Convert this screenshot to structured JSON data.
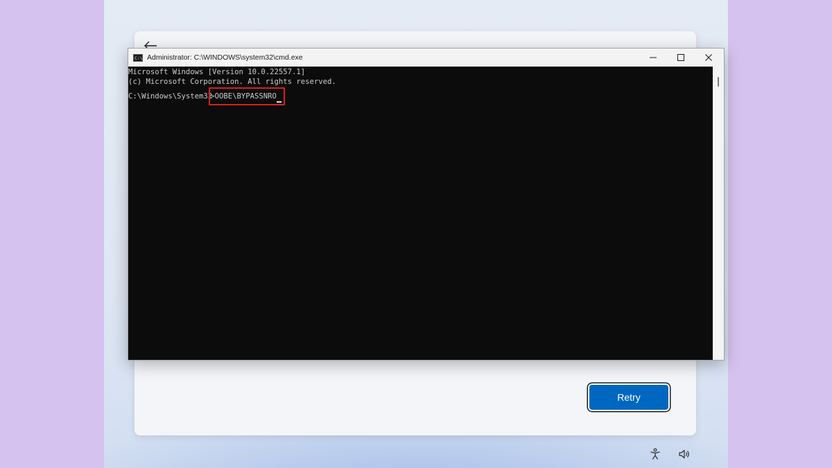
{
  "cmd": {
    "title": "Administrator: C:\\WINDOWS\\system32\\cmd.exe",
    "icon_text": "C:\\",
    "lines": [
      "Microsoft Windows [Version 10.0.22557.1]",
      "(c) Microsoft Corporation. All rights reserved."
    ],
    "prompt": "C:\\Windows\\System32",
    "command": ">OOBE\\BYPASSNRO",
    "highlight_color": "#d42222"
  },
  "oobe": {
    "retry_label": "Retry",
    "accent_color": "#0067c0"
  },
  "icons": {
    "back": "back-arrow-icon",
    "accessibility": "accessibility-icon",
    "volume": "volume-icon",
    "minimize": "minimize-icon",
    "maximize": "maximize-icon",
    "close": "close-icon"
  }
}
